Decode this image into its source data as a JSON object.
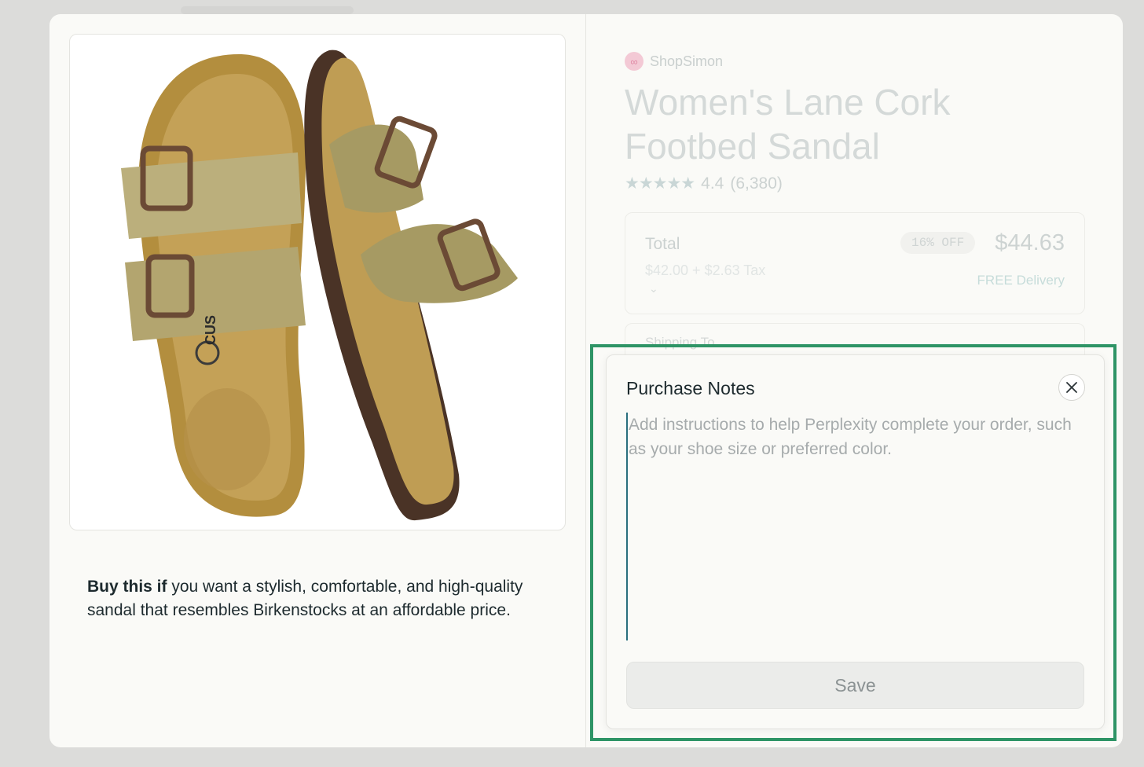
{
  "product": {
    "image_alt": "sandal-product-image",
    "blurb_bold": "Buy this if",
    "blurb_rest": " you want a stylish, comfortable, and high-quality sandal that resembles Birkenstocks at an affordable price."
  },
  "details": {
    "brand": "ShopSimon",
    "title": "Women's Lane Cork Footbed Sandal",
    "stars": "★★★★★",
    "rating": "4.4",
    "reviews": "(6,380)",
    "total_label": "Total",
    "total_breakdown": "$42.00 + $2.63 Tax",
    "discount": "16% OFF",
    "price": "$44.63",
    "delivery": "FREE Delivery",
    "shipping_label": "Shipping To"
  },
  "modal": {
    "title": "Purchase Notes",
    "placeholder": "Add instructions to help Perplexity complete your order, such as your shoe size or preferred color.",
    "save_label": "Save"
  },
  "colors": {
    "highlight": "#2e9466",
    "sole": "#4a3326",
    "strap": "#b3a56f",
    "cork": "#bf9d54"
  }
}
